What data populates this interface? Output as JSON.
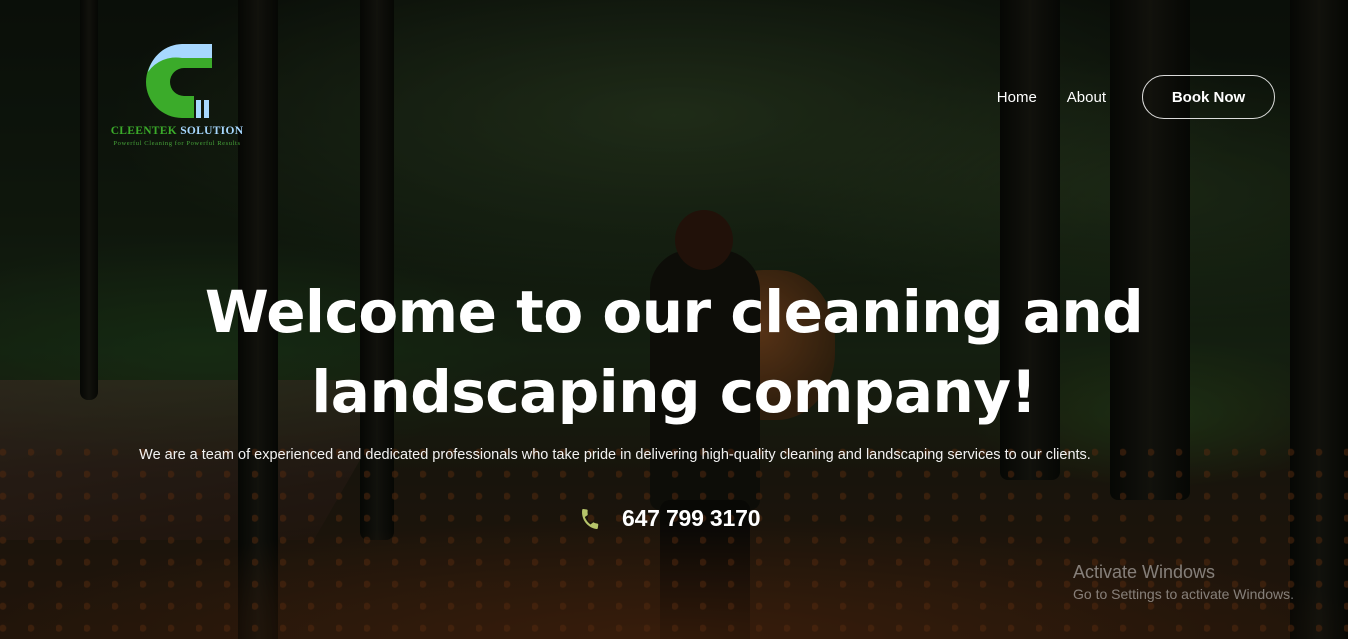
{
  "logo": {
    "brand_part1": "CLEENTEK",
    "brand_part2": "SOLUTION",
    "tagline": "Powerful Cleaning for Powerful Results"
  },
  "nav": {
    "items": [
      {
        "label": "Home"
      },
      {
        "label": "About"
      }
    ],
    "cta_label": "Book Now"
  },
  "hero": {
    "title_line1": "Welcome to our cleaning and",
    "title_line2": "landscaping company!",
    "subtitle": "We are a team of experienced and dedicated professionals who take pride in delivering high-quality cleaning and landscaping services to our clients.",
    "phone": "647 799 3170",
    "phone_icon": "phone-icon"
  },
  "watermark": {
    "line1": "Activate Windows",
    "line2": "Go to Settings to activate Windows."
  },
  "colors": {
    "logo_green": "#3bab2a",
    "logo_blue": "#a7d8ff",
    "phone_icon": "#b6c46a"
  }
}
